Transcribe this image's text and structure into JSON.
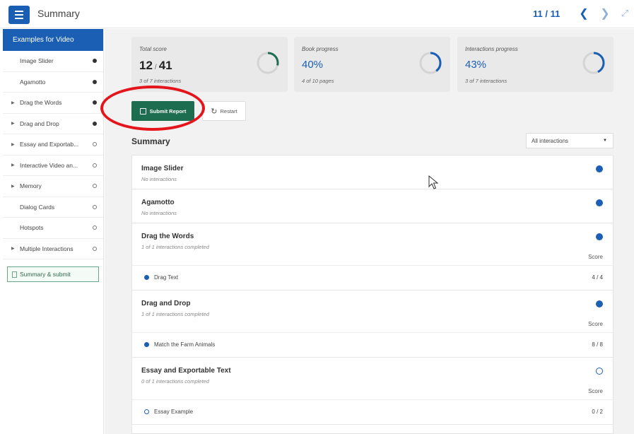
{
  "topbar": {
    "title": "Summary",
    "page_counter": "11 / 11",
    "prev_icon": "chevron-left-icon",
    "next_icon": "chevron-right-icon",
    "fullscreen_icon": "fullscreen-icon"
  },
  "sidebar": {
    "header": "Examples for Video",
    "items": [
      {
        "label": "Image Slider",
        "expandable": false,
        "status": "filled"
      },
      {
        "label": "Agamotto",
        "expandable": false,
        "status": "filled"
      },
      {
        "label": "Drag the Words",
        "expandable": true,
        "status": "filled"
      },
      {
        "label": "Drag and Drop",
        "expandable": true,
        "status": "filled"
      },
      {
        "label": "Essay and Exportab...",
        "expandable": true,
        "status": "empty"
      },
      {
        "label": "Interactive Video an...",
        "expandable": true,
        "status": "empty"
      },
      {
        "label": "Memory",
        "expandable": true,
        "status": "empty"
      },
      {
        "label": "Dialog Cards",
        "expandable": false,
        "status": "empty"
      },
      {
        "label": "Hotspots",
        "expandable": false,
        "status": "empty"
      },
      {
        "label": "Multiple Interactions",
        "expandable": true,
        "status": "empty"
      }
    ],
    "summary_item": "Summary & submit"
  },
  "cards": {
    "total_score": {
      "label": "Total score",
      "score": "12",
      "max": "41",
      "sub": "3 of 7 interactions",
      "fraction": 0.29
    },
    "book_progress": {
      "label": "Book progress",
      "value": "40%",
      "sub": "4 of 10 pages",
      "fraction": 0.4
    },
    "interactions_progress": {
      "label": "Interactions progress",
      "value": "43%",
      "sub": "3 of 7 interactions",
      "fraction": 0.43
    }
  },
  "actions": {
    "submit_label": "Submit Report",
    "restart_label": "Restart"
  },
  "summary": {
    "title": "Summary",
    "filter_value": "All interactions",
    "score_label": "Score",
    "entries": [
      {
        "title": "Image Slider",
        "sub": "No interactions",
        "status": "filled"
      },
      {
        "title": "Agamotto",
        "sub": "No interactions",
        "status": "filled"
      },
      {
        "title": "Drag the Words",
        "sub": "1 of 1 interactions completed",
        "status": "filled",
        "item": {
          "label": "Drag Text",
          "score": "4 / 4",
          "status": "filled"
        }
      },
      {
        "title": "Drag and Drop",
        "sub": "1 of 1 interactions completed",
        "status": "filled",
        "item": {
          "label": "Match the Farm Animals",
          "score": "8 / 8",
          "status": "filled"
        }
      },
      {
        "title": "Essay and Exportable Text",
        "sub": "0 of 1 interactions completed",
        "status": "empty",
        "item": {
          "label": "Essay Example",
          "score": "0 / 2",
          "status": "empty"
        }
      }
    ]
  },
  "colors": {
    "accent": "#1a5fb4",
    "submit_green": "#1d6e50",
    "highlight_red": "#e4161b"
  }
}
